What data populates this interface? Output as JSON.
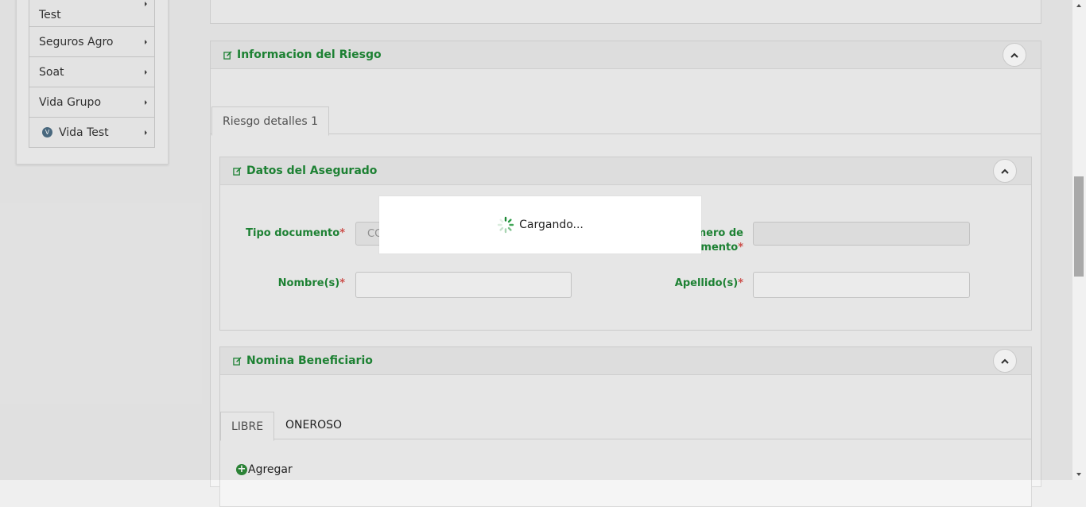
{
  "sidebar": {
    "items": [
      {
        "label": "Test"
      },
      {
        "label": "Seguros Agro"
      },
      {
        "label": "Soat"
      },
      {
        "label": "Vida Grupo"
      },
      {
        "label": "Vida Test",
        "icon": "vida-icon"
      }
    ]
  },
  "riesgo_panel": {
    "title": "Informacion del Riesgo",
    "tab": "Riesgo detalles 1"
  },
  "asegurado_panel": {
    "title": "Datos del Asegurado",
    "fields": {
      "tipo_documento_label": "Tipo documento",
      "tipo_documento_value": "CC",
      "numero_documento_label_l1": "mero de",
      "numero_documento_label_l2": "umento",
      "nombres_label": "Nombre(s)",
      "apellidos_label": "Apellido(s)",
      "required_mark": "*"
    }
  },
  "beneficiario_panel": {
    "title": "Nomina Beneficiario",
    "tabs": [
      "LIBRE",
      "ONEROSO"
    ],
    "add_label": "Agregar"
  },
  "loading": {
    "text": "Cargando..."
  },
  "colors": {
    "accent_green": "#1f8a37",
    "required_red": "#d9534f"
  }
}
